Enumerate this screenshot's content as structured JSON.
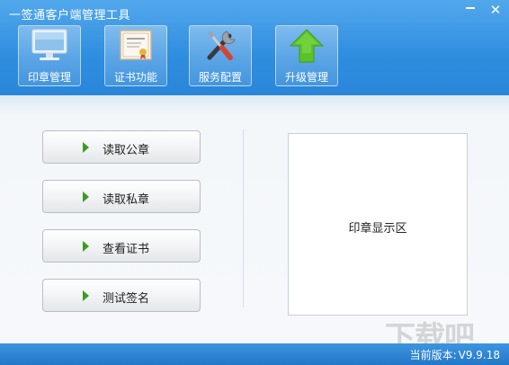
{
  "window": {
    "title": "一签通客户端管理工具",
    "minimize_symbol": "_",
    "close_symbol": "✕"
  },
  "toolbar": [
    {
      "label": "印章管理",
      "icon": "monitor-icon"
    },
    {
      "label": "证书功能",
      "icon": "certificate-icon"
    },
    {
      "label": "服务配置",
      "icon": "tools-icon"
    },
    {
      "label": "升级管理",
      "icon": "up-arrow-icon"
    }
  ],
  "actions": [
    {
      "label": "读取公章"
    },
    {
      "label": "读取私章"
    },
    {
      "label": "查看证书"
    },
    {
      "label": "测试签名"
    }
  ],
  "seal_area": {
    "label": "印章显示区"
  },
  "status": {
    "version_label": "当前版本:",
    "version_value": "V9.9.18"
  },
  "watermark": {
    "text": "下载吧"
  },
  "colors": {
    "header_blue": "#2f8ddf",
    "status_blue": "#2377c8",
    "arrow_green": "#3f9a25",
    "upgrade_green": "#5cc22a"
  }
}
